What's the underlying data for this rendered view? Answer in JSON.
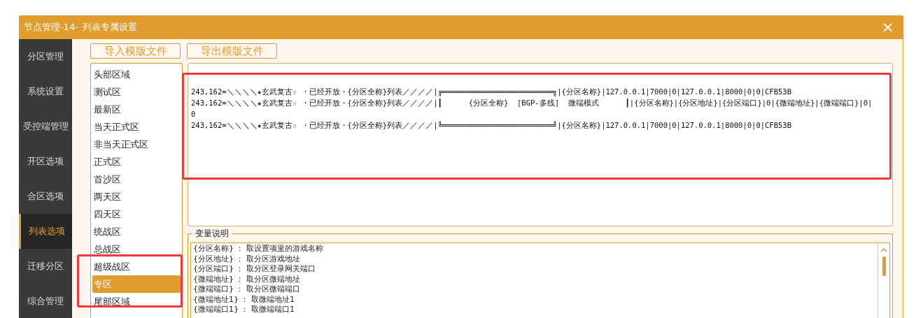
{
  "window": {
    "title_prefix": "节点管理-14-",
    "title": "列表专属设置",
    "close": "×"
  },
  "sidebar": {
    "items": [
      {
        "label": "分区管理",
        "selected": false
      },
      {
        "label": "系统设置",
        "selected": false
      },
      {
        "label": "受控端管理",
        "selected": false
      },
      {
        "label": "开区选项",
        "selected": false
      },
      {
        "label": "合区选项",
        "selected": false
      },
      {
        "label": "列表选项",
        "selected": true
      },
      {
        "label": "迁移分区",
        "selected": false
      },
      {
        "label": "综合管理",
        "selected": false
      }
    ]
  },
  "buttons": [
    "导入模版文件",
    "导出模版文件"
  ],
  "region_list": {
    "items": [
      {
        "label": "头部区域",
        "selected": false
      },
      {
        "label": "测试区",
        "selected": false
      },
      {
        "label": "最新区",
        "selected": false
      },
      {
        "label": "当天正式区",
        "selected": false
      },
      {
        "label": "非当天正式区",
        "selected": false
      },
      {
        "label": "正式区",
        "selected": false
      },
      {
        "label": "首沙区",
        "selected": false
      },
      {
        "label": "两天区",
        "selected": false
      },
      {
        "label": "四天区",
        "selected": false
      },
      {
        "label": "统战区",
        "selected": false
      },
      {
        "label": "总战区",
        "selected": false
      },
      {
        "label": "超级战区",
        "selected": false
      },
      {
        "label": "专区",
        "selected": true
      },
      {
        "label": "尾部区域",
        "selected": false
      }
    ]
  },
  "template_editor": {
    "lines": [
      "243,162=＼＼＼＼★玄武复古☆ ・已经开放・{分区全称}列表／／／／|╔═════════════════════════╗|{分区名称}|127.0.0.1|7000|0|127.0.0.1|8000|0|0|CFB53B",
      "243,162=＼＼＼＼★玄武复古☆ ・已经开放・{分区全称}列表／／／／|┃      {分区全称}  [BGP-多线]  微端模式      ┃|{分区名称}|{分区地址}|{分区端口}|0|{微端地址}|{微端端口}|0|0",
      "243,162=＼＼＼＼★玄武复古☆ ・已经开放・{分区全称}列表／／／／|╚═════════════════════════╝|{分区名称}|127.0.0.1|7000|0|127.0.0.1|8000|0|0|CFB53B"
    ]
  },
  "variables": {
    "title": "变量说明",
    "lines": [
      "{分区名称} ： 取设置项里的游戏名称",
      "{分区地址} ： 取分区游戏地址",
      "{分区端口} ： 取分区登录网关端口",
      "{微端地址} ： 取分区微端地址",
      "{微端端口} ： 取分区微端端口",
      "{微端地址1} ： 取微端地址1",
      "{微端端口1} ： 取微端端口1"
    ]
  }
}
